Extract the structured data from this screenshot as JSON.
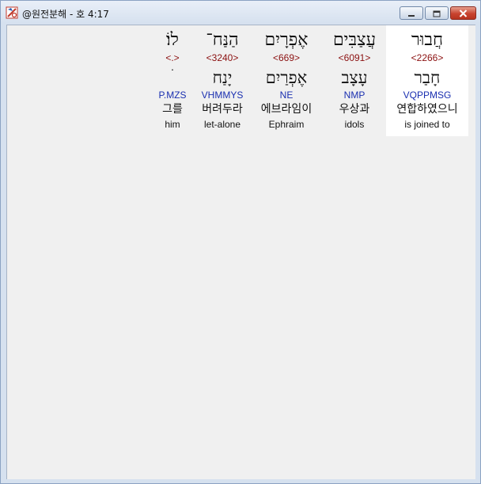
{
  "window": {
    "title": "@원전분해 - 호 4:17"
  },
  "words": [
    {
      "hebrew": "חֲבוּר",
      "strong": "<2266>",
      "lexeme": "חָבַר",
      "morph": "VQPPMSG",
      "korean": "연합하였으니",
      "english": "is joined to"
    },
    {
      "hebrew": "עֲצַבִּים",
      "strong": "<6091>",
      "lexeme": "עָצָב",
      "morph": "NMP",
      "korean": "우상과",
      "english": "idols"
    },
    {
      "hebrew": "אֶפְרָיִם",
      "strong": "<669>",
      "lexeme": "אֶפְרַיִם",
      "morph": "NE",
      "korean": "에브라임이",
      "english": "Ephraim"
    },
    {
      "hebrew": "הַנַּח־",
      "strong": "<3240>",
      "lexeme": "יָנַח",
      "morph": "VHMMYS",
      "korean": "버려두라",
      "english": "let-alone"
    },
    {
      "hebrew": "לוֹ׃",
      "strong": "<.>",
      "lexeme": "ׄ",
      "morph": "P.MZS",
      "korean": "그를",
      "english": "him"
    }
  ]
}
